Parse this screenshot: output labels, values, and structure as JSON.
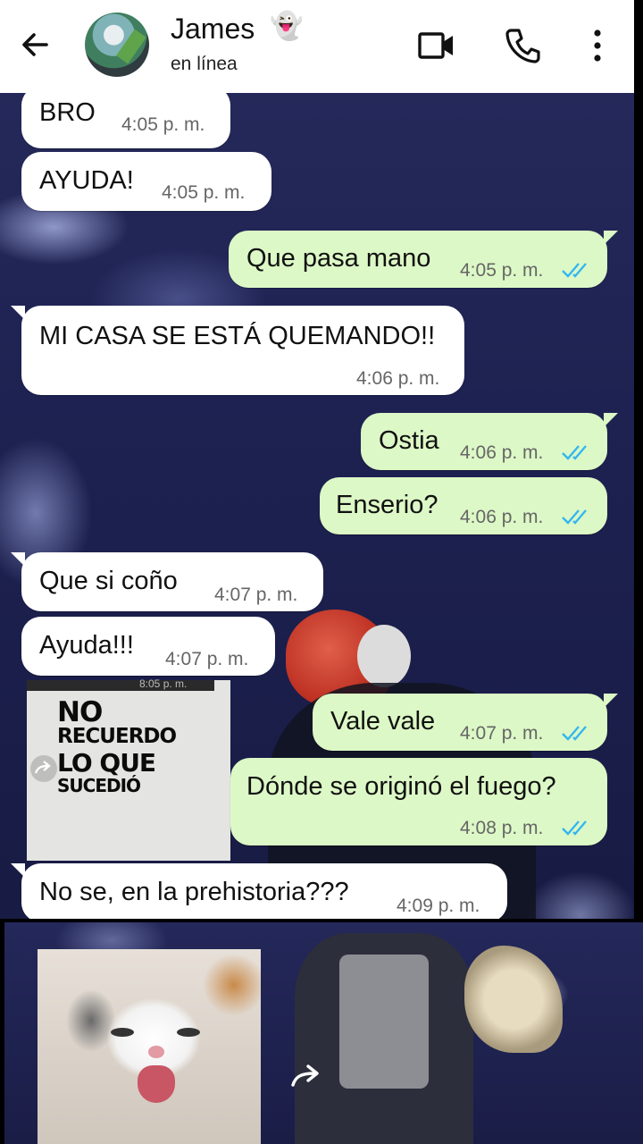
{
  "header": {
    "contact_name": "James",
    "contact_emoji": "👻",
    "status": "en línea",
    "icons": [
      "back-arrow-icon",
      "video-call-icon",
      "phone-icon",
      "more-vert-icon"
    ]
  },
  "messages": [
    {
      "dir": "in",
      "text": "BRO",
      "time": "4:05 p. m."
    },
    {
      "dir": "in",
      "text": "AYUDA!",
      "time": "4:05 p. m."
    },
    {
      "dir": "out",
      "text": "Que pasa mano",
      "time": "4:05 p. m."
    },
    {
      "dir": "in",
      "text": "MI CASA SE ESTÁ QUEMANDO!!",
      "time": "4:06 p. m."
    },
    {
      "dir": "out",
      "text": "Ostia",
      "time": "4:06 p. m."
    },
    {
      "dir": "out",
      "text": "Enserio?",
      "time": "4:06 p. m."
    },
    {
      "dir": "in",
      "text": "Que si coño",
      "time": "4:07 p. m."
    },
    {
      "dir": "in",
      "text": "Ayuda!!!",
      "time": "4:07 p. m."
    },
    {
      "dir": "out",
      "text": "Vale vale",
      "time": "4:07 p. m."
    },
    {
      "dir": "out",
      "text": "Dónde se originó el fuego?",
      "time": "4:08 p. m."
    },
    {
      "dir": "in",
      "text": "No se, en la prehistoria???",
      "time": "4:09 p. m."
    }
  ],
  "sticker": {
    "lines": [
      "NO",
      "RECUERDO",
      "LO QUE",
      "SUCEDIÓ"
    ],
    "time": "8:05 p. m."
  },
  "colors": {
    "incoming_bubble": "#ffffff",
    "outgoing_bubble": "#dcf8c6",
    "read_ticks": "#34b7f1"
  }
}
